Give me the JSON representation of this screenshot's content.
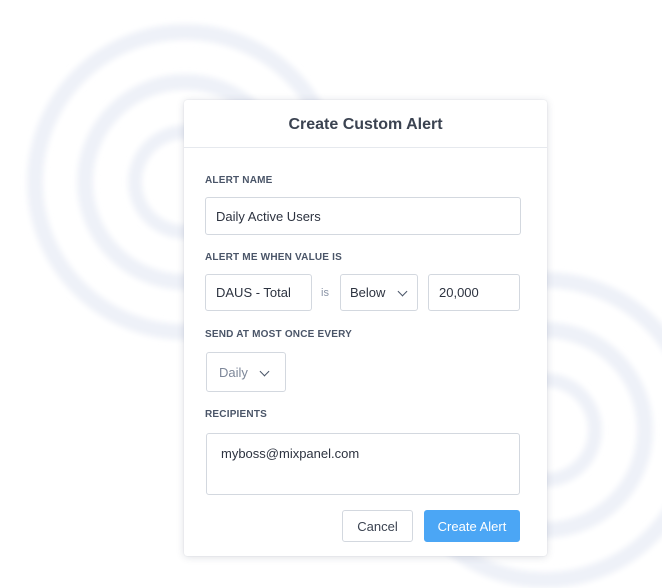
{
  "dialog": {
    "title": "Create Custom Alert"
  },
  "alert_name": {
    "label": "ALERT NAME",
    "value": "Daily Active Users"
  },
  "condition": {
    "label": "ALERT ME WHEN VALUE IS",
    "metric": "DAUS - Total",
    "is_text": "is",
    "comparator": "Below",
    "threshold": "20,000"
  },
  "frequency": {
    "label": "SEND AT MOST ONCE EVERY",
    "value": "Daily"
  },
  "recipients": {
    "label": "RECIPIENTS",
    "value": "myboss@mixpanel.com"
  },
  "actions": {
    "cancel_label": "Cancel",
    "create_label": "Create Alert"
  },
  "colors": {
    "primary": "#4ba6f5",
    "title_text": "#3b4351",
    "border": "#d3d8df"
  },
  "icons": {
    "select_arrow": "chevron-down-icon"
  }
}
